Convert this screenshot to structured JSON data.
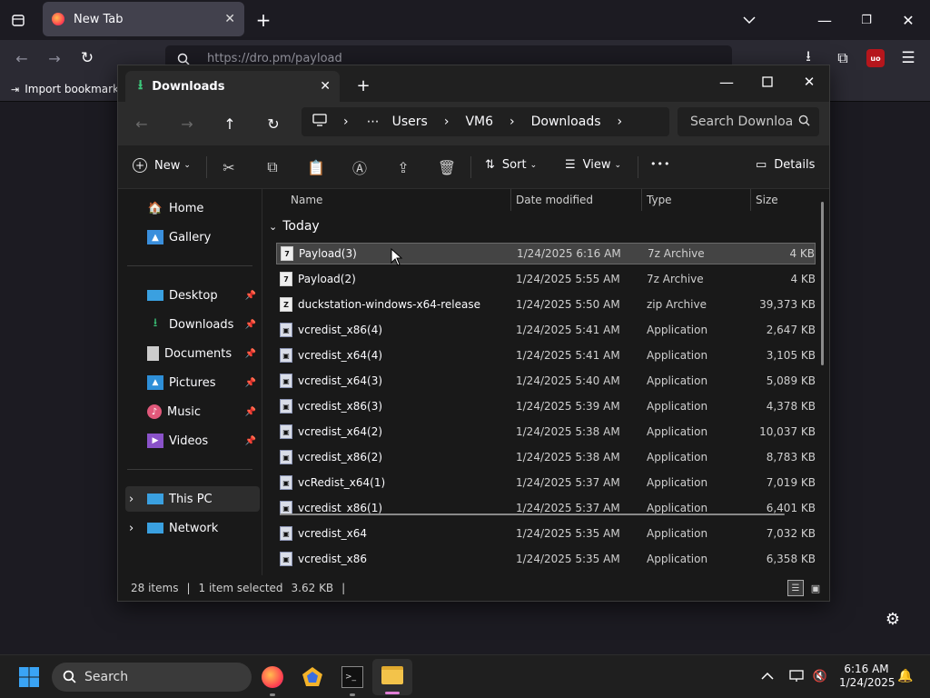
{
  "browser": {
    "tab_title": "New Tab",
    "url_placeholder": "https://dro.pm/payload",
    "bookmark_label": "Import bookmarks",
    "extension_badge": "uo"
  },
  "explorer": {
    "tab_title": "Downloads",
    "breadcrumb": [
      "Users",
      "VM6",
      "Downloads"
    ],
    "search_placeholder": "Search Downloa",
    "toolbar": {
      "new_label": "New",
      "sort_label": "Sort",
      "view_label": "View",
      "more_label": "•••",
      "details_label": "Details"
    },
    "nav": {
      "home": "Home",
      "gallery": "Gallery",
      "desktop": "Desktop",
      "downloads": "Downloads",
      "documents": "Documents",
      "pictures": "Pictures",
      "music": "Music",
      "videos": "Videos",
      "this_pc": "This PC",
      "network": "Network"
    },
    "columns": {
      "name": "Name",
      "date": "Date modified",
      "type": "Type",
      "size": "Size"
    },
    "group_label": "Today",
    "files": [
      {
        "name": "Payload(3)",
        "date": "1/24/2025 6:16 AM",
        "type": "7z Archive",
        "size": "4 KB",
        "icon": "7z"
      },
      {
        "name": "Payload(2)",
        "date": "1/24/2025 5:55 AM",
        "type": "7z Archive",
        "size": "4 KB",
        "icon": "7z"
      },
      {
        "name": "duckstation-windows-x64-release",
        "date": "1/24/2025 5:50 AM",
        "type": "zip Archive",
        "size": "39,373 KB",
        "icon": "zip"
      },
      {
        "name": "vcredist_x86(4)",
        "date": "1/24/2025 5:41 AM",
        "type": "Application",
        "size": "2,647 KB",
        "icon": "app"
      },
      {
        "name": "vcredist_x64(4)",
        "date": "1/24/2025 5:41 AM",
        "type": "Application",
        "size": "3,105 KB",
        "icon": "app"
      },
      {
        "name": "vcredist_x64(3)",
        "date": "1/24/2025 5:40 AM",
        "type": "Application",
        "size": "5,089 KB",
        "icon": "app"
      },
      {
        "name": "vcredist_x86(3)",
        "date": "1/24/2025 5:39 AM",
        "type": "Application",
        "size": "4,378 KB",
        "icon": "app"
      },
      {
        "name": "vcredist_x64(2)",
        "date": "1/24/2025 5:38 AM",
        "type": "Application",
        "size": "10,037 KB",
        "icon": "app"
      },
      {
        "name": "vcredist_x86(2)",
        "date": "1/24/2025 5:38 AM",
        "type": "Application",
        "size": "8,783 KB",
        "icon": "app"
      },
      {
        "name": "vcRedist_x64(1)",
        "date": "1/24/2025 5:37 AM",
        "type": "Application",
        "size": "7,019 KB",
        "icon": "app"
      },
      {
        "name": "vcredist_x86(1)",
        "date": "1/24/2025 5:37 AM",
        "type": "Application",
        "size": "6,401 KB",
        "icon": "app"
      },
      {
        "name": "vcredist_x64",
        "date": "1/24/2025 5:35 AM",
        "type": "Application",
        "size": "7,032 KB",
        "icon": "app"
      },
      {
        "name": "vcredist_x86",
        "date": "1/24/2025 5:35 AM",
        "type": "Application",
        "size": "6,358 KB",
        "icon": "app"
      }
    ],
    "status": {
      "items": "28 items",
      "selected": "1 item selected",
      "size": "3.62 KB"
    }
  },
  "taskbar": {
    "search_label": "Search",
    "time": "6:16 AM",
    "date": "1/24/2025"
  }
}
